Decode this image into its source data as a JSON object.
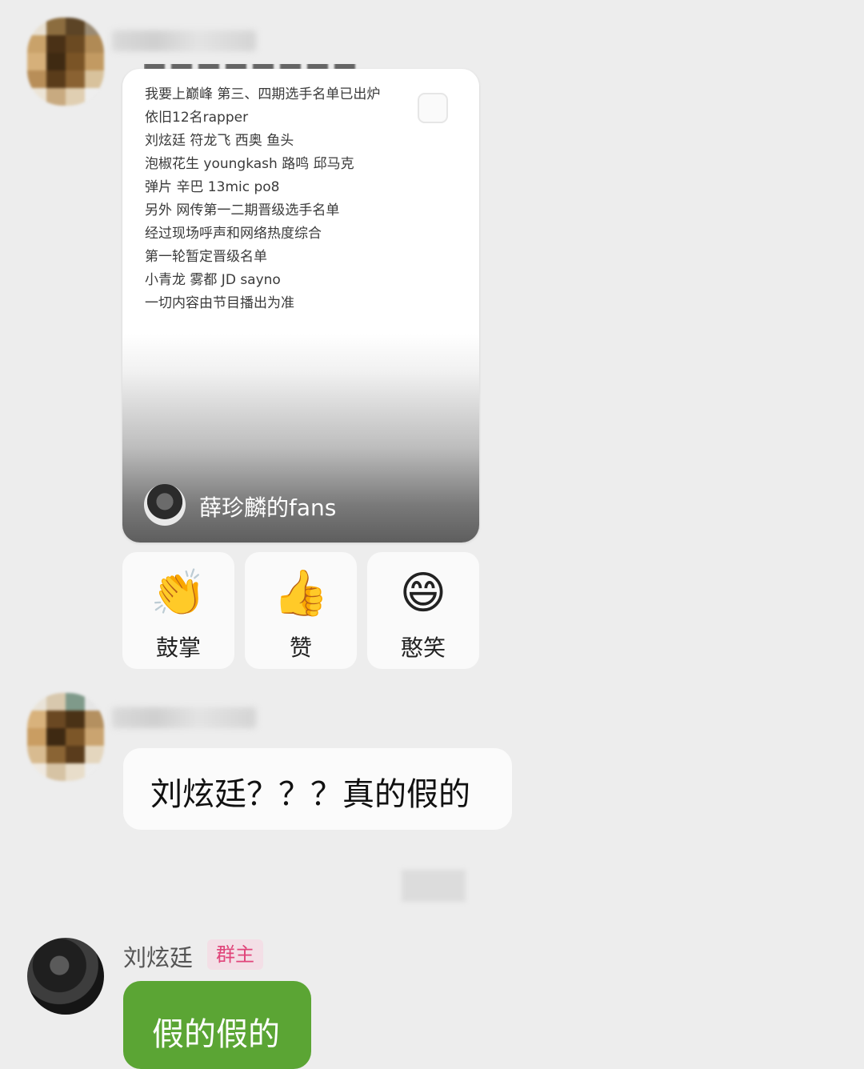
{
  "card": {
    "lines": [
      "我要上巅峰 第三、四期选手名单已出炉",
      "依旧12名rapper",
      "刘炫廷   符龙飞   西奥   鱼头",
      "泡椒花生   youngkash   路鸣   邱马克",
      "弹片   辛巴   13mic   po8",
      "另外 网传第一二期晋级选手名单",
      "经过现场呼声和网络热度综合",
      "第一轮暂定晋级名单",
      "小青龙  雾都  JD  sayno",
      "一切内容由节目播出为准"
    ],
    "author": "薛珍麟的fans"
  },
  "reactions": [
    {
      "label": "鼓掌",
      "icon": "clap-icon",
      "glyph": "👏"
    },
    {
      "label": "赞",
      "icon": "thumbs-up-icon",
      "glyph": "👍"
    },
    {
      "label": "憨笑",
      "icon": "grin-icon",
      "glyph": "😄"
    }
  ],
  "messages": {
    "question": "刘炫廷？？？真的假的",
    "reply": "假的假的"
  },
  "owner": {
    "name": "刘炫廷",
    "badge": "群主"
  },
  "colors": {
    "background": "#ededed",
    "bubble_green": "#5ba534",
    "badge_text": "#e0457a",
    "badge_bg": "#f3dfe6"
  }
}
